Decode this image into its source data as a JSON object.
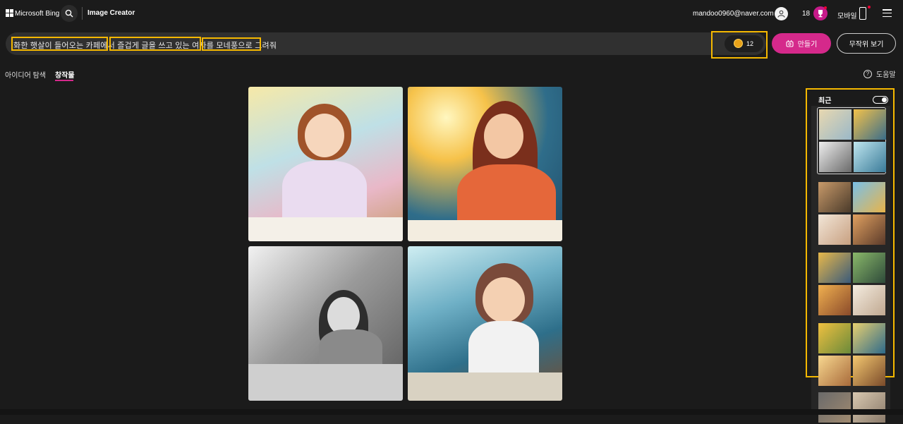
{
  "header": {
    "brand": "Microsoft Bing",
    "title": "Image Creator",
    "account_email": "mandoo0960@naver.com",
    "rewards_count": "18",
    "mobile_label": "모바일"
  },
  "prompt": {
    "segments": [
      "화한 햇살이 들어오는 카페에서",
      "즐겁게 글을 쓰고 있는 여자를",
      "모네풍으로 그려줘"
    ],
    "boost_count": "12",
    "create_label": "만들기",
    "surprise_label": "무작위 보기"
  },
  "tabs": [
    {
      "label": "아이디어 탐색",
      "active": false
    },
    {
      "label": "창작물",
      "active": true
    }
  ],
  "help_label": "도움말",
  "recent": {
    "title": "최근",
    "toggle_on": true
  },
  "colors": {
    "accent": "#d5298b",
    "highlight_box": "#f5b800",
    "background": "#1b1b1b"
  },
  "icons": [
    "windows-logo-icon",
    "search-icon",
    "user-icon",
    "trophy-icon",
    "phone-icon",
    "menu-icon",
    "coin-icon",
    "create-icon",
    "help-icon"
  ]
}
